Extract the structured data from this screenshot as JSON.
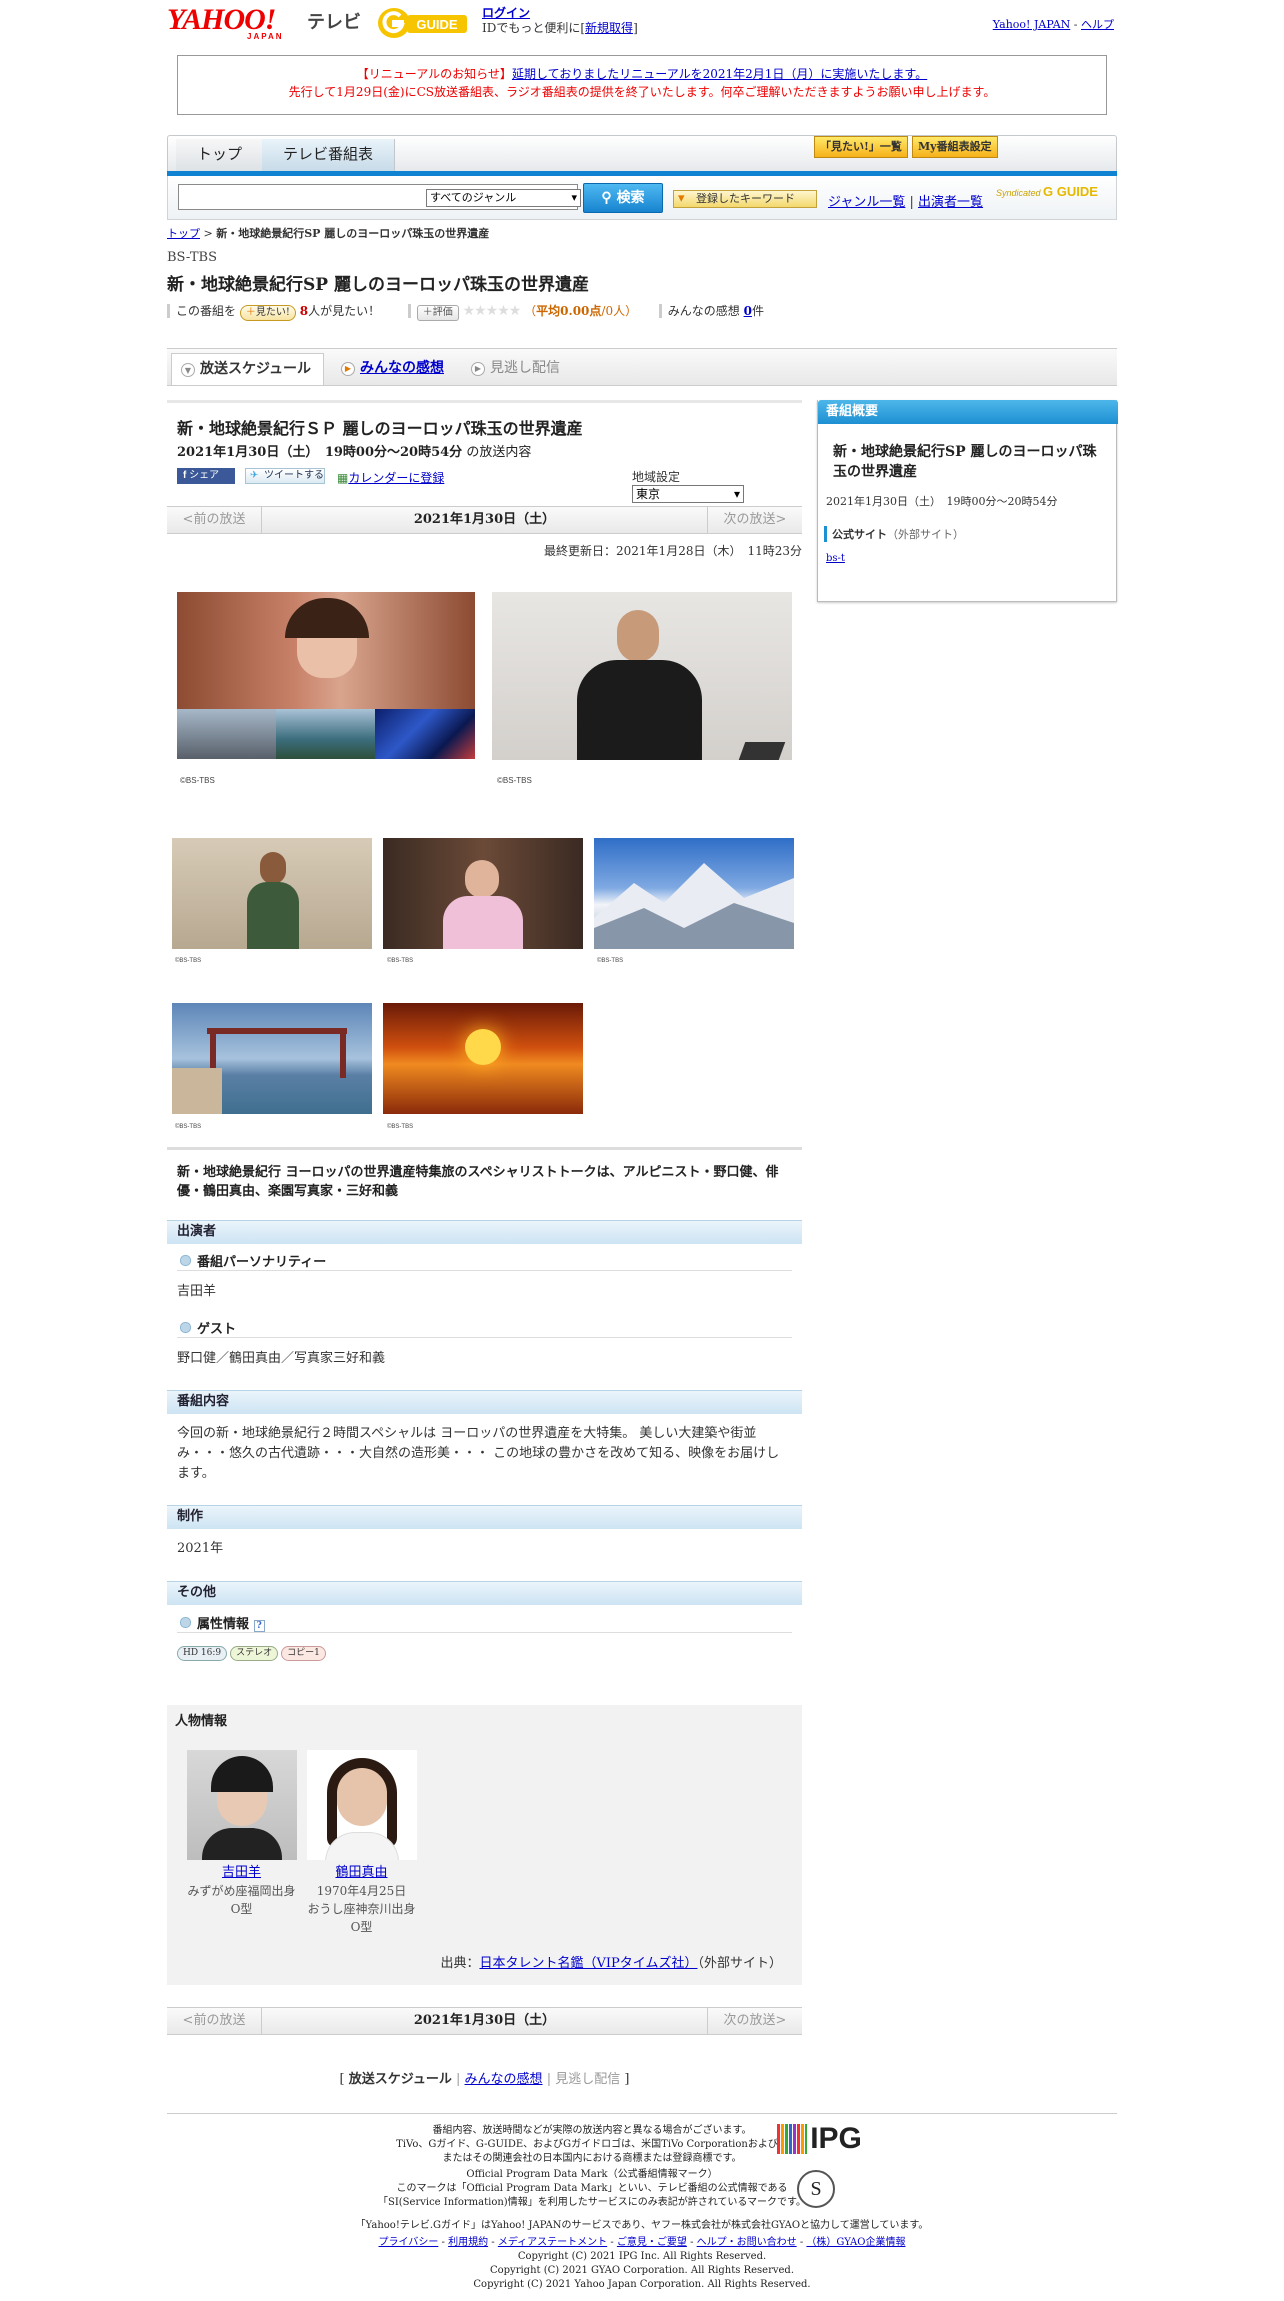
{
  "header": {
    "yahoo_logo": "YAHOO!",
    "yahoo_sub": "JAPAN",
    "tv": "テレビ",
    "gguide_logo": "G GUIDE",
    "login": "ログイン",
    "login_prefix": "IDでもっと便利に[",
    "register": "新規取得",
    "login_suffix": "]",
    "yahoo_japan": "Yahoo! JAPAN",
    "help": "ヘルプ",
    "sep": " - "
  },
  "notice": {
    "label": "【リニューアルのお知らせ】",
    "link": "延期しておりましたリニューアルを2021年2月1日（月）に実施いたします。",
    "line2": "先行して1月29日(金)にCS放送番組表、ラジオ番組表の提供を終了いたします。何卒ご理解いただきますようお願い申し上げます。"
  },
  "nav": {
    "top": "トップ",
    "tv_schedule": "テレビ番組表",
    "mitai_list": "「見たい!」一覧",
    "my_schedule": "My番組表設定"
  },
  "search": {
    "genre": "すべてのジャンル",
    "button": "検索",
    "keyword": "登録したキーワード",
    "genre_list": "ジャンル一覧",
    "divider": "|",
    "performer_list": "出演者一覧",
    "syndicated": "Syndicated",
    "gguide": "G GUIDE"
  },
  "program": {
    "breadcrumb_top": "トップ",
    "breadcrumb_sep": " > ",
    "breadcrumb_current": "新・地球絶景紀行SP 麗しのヨーロッパ珠玉の世界遺産",
    "channel": "BS-TBS",
    "title": "新・地球絶景紀行SP 麗しのヨーロッパ珠玉の世界遺産",
    "rating_prefix": "この番組を",
    "mitai_button": "見たい!",
    "mitai_count": "8",
    "mitai_suffix": "人が見たい！",
    "hyoka_button": "評価",
    "stars": "★★★★★",
    "avg_open": "（",
    "avg": "平均0.00点",
    "avg_people": "/0人）",
    "kansou_prefix": "みんなの感想",
    "kansou_count": "0",
    "kansou_suffix": "件"
  },
  "tabs": {
    "schedule": "放送スケジュール",
    "kansou": "みんなの感想",
    "minogashi": "見逃し配信"
  },
  "broadcast": {
    "title": "新・地球絶景紀行ＳＰ 麗しのヨーロッパ珠玉の世界遺産",
    "datetime": "2021年1月30日（土）　19時00分～20時54分",
    "datetime_suffix": "の放送内容",
    "fb": "シェア",
    "tweet": "ツイートする",
    "calendar": "カレンダーに登録",
    "region_label": "地域設定",
    "region": "東京",
    "updated": "最終更新日：2021年1月28日（木）　11時23分"
  },
  "pager": {
    "prev": "<前の放送",
    "date": "2021年1月30日（土）",
    "next": "次の放送>"
  },
  "photos": {
    "large_caption": "©BS-TBS",
    "small_caption": "©BS-TBS"
  },
  "description": "新・地球絶景紀行 ヨーロッパの世界遺産特集旅のスペシャリストトークは、アルピニスト・野口健、俳優・鶴田真由、楽園写真家・三好和義",
  "sections": {
    "cast": "出演者",
    "personality_label": "番組パーソナリティー",
    "personality": "吉田羊",
    "guest_label": "ゲスト",
    "guest": "野口健／鶴田真由／写真家三好和義",
    "content": "番組内容",
    "content_text": "今回の新・地球絶景紀行２時間スペシャルは ヨーロッパの世界遺産を大特集。 美しい大建築や街並み・・・悠久の古代遺跡・・・大自然の造形美・・・ この地球の豊かさを改めて知る、映像をお届けします。",
    "production": "制作",
    "year": "2021年",
    "other": "その他",
    "attr_label": "属性情報",
    "attr_help": "?",
    "badge_hd": "HD 16:9",
    "badge_stereo": "ステレオ",
    "badge_copy": "コピー1"
  },
  "persons": {
    "title": "人物情報",
    "list": [
      {
        "name": "吉田羊",
        "line1": "みずがめ座福岡出身",
        "line2": "O型",
        "line3": ""
      },
      {
        "name": "鶴田真由",
        "line1": "1970年4月25日",
        "line2": "おうし座神奈川出身",
        "line3": "O型"
      }
    ],
    "source_prefix": "出典：",
    "source_link": "日本タレント名鑑（VIPタイムズ社）",
    "source_suffix": "（外部サイト）"
  },
  "sidebar": {
    "title": "番組概要",
    "program_title": "新・地球絶景紀行SP 麗しのヨーロッパ珠玉の世界遺産",
    "datetime": "2021年1月30日（土）　19時00分～20時54分",
    "official_label": "公式サイト",
    "official_external": "（外部サイト）",
    "official_link": "bs-t"
  },
  "bottom_tabs": {
    "open": "[",
    "schedule": "放送スケジュール",
    "sep": "|",
    "kansou": "みんなの感想",
    "minogashi": "見逃し配信",
    "close": "]"
  },
  "footer": {
    "l1": "番組内容、放送時間などが実際の放送内容と異なる場合がございます。",
    "l2": "TiVo、Gガイド、G-GUIDE、およびGガイドロゴは、米国TiVo Corporationおよび／",
    "l3": "またはその関連会社の日本国内における商標または登録商標です。",
    "ipg": "IPG",
    "l4": "Official Program Data Mark（公式番組情報マーク）",
    "l5": "このマークは「Official Program Data Mark」といい、テレビ番組の公式情報である",
    "l6": "「SI(Service Information)情報」を利用したサービスにのみ表記が許されているマークです。",
    "s_mark": "S",
    "l7": "「Yahoo!テレビ.Gガイド」はYahoo! JAPANのサービスであり、ヤフー株式会社が株式会社GYAOと協力して運営しています。",
    "links": [
      "プライバシー",
      "利用規約",
      "メディアステートメント",
      "ご意見・ご要望",
      "ヘルプ・お問い合わせ",
      "（株）GYAO企業情報"
    ],
    "link_sep": " - ",
    "c1": "Copyright (C) 2021 IPG Inc. All Rights Reserved.",
    "c2": "Copyright (C) 2021 GYAO Corporation. All Rights Reserved.",
    "c3": "Copyright (C) 2021 Yahoo Japan Corporation. All Rights Reserved."
  },
  "colors": {
    "accent_red": "#e00000",
    "link": "#0000cc",
    "nav_blue": "#0f82d1"
  }
}
